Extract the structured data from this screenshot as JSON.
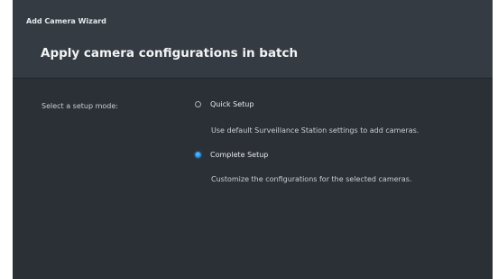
{
  "window": {
    "title": "Add Camera Wizard"
  },
  "header": {
    "title": "Apply camera configurations in batch"
  },
  "setup": {
    "label": "Select a setup mode:",
    "options": [
      {
        "label": "Quick Setup",
        "description": "Use default Surveillance Station settings to add cameras.",
        "selected": false
      },
      {
        "label": "Complete Setup",
        "description": "Customize the configurations for the selected cameras.",
        "selected": true
      }
    ]
  },
  "colors": {
    "background": "#2b3036",
    "header": "#353b42",
    "accent": "#1a8fe8",
    "text": "#e6e9ec"
  }
}
